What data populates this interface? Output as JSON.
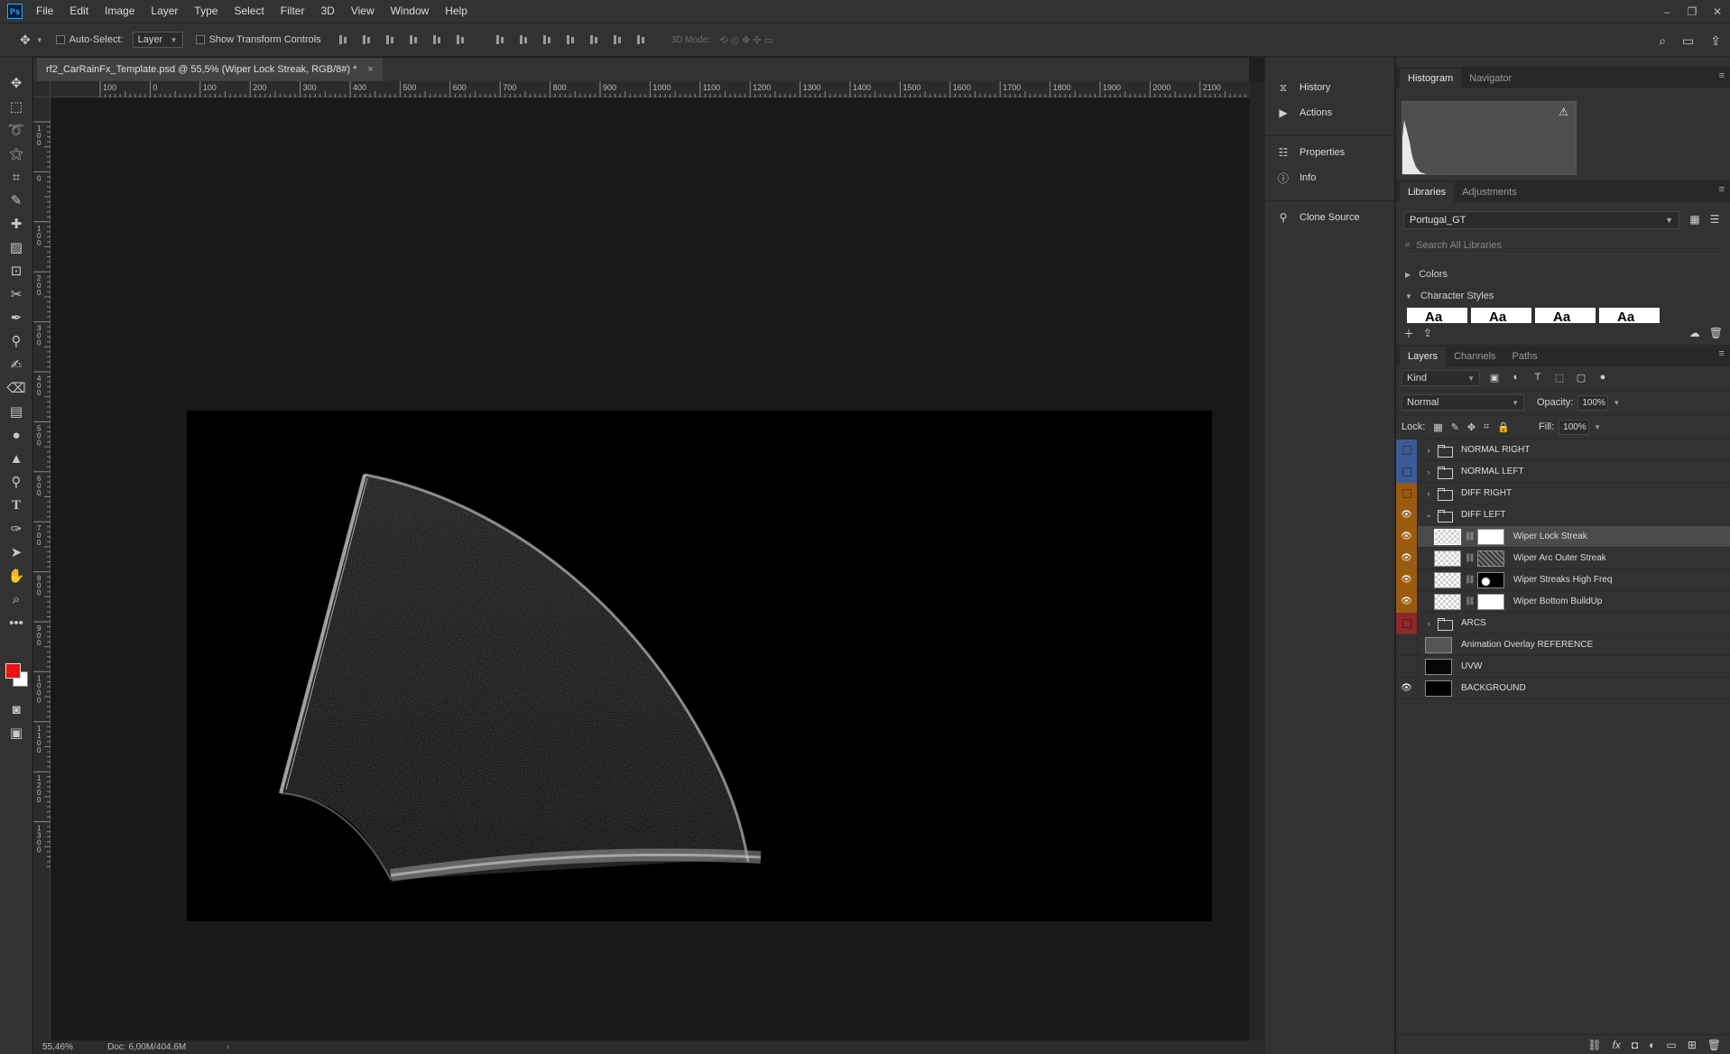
{
  "app": {
    "logo": "Ps"
  },
  "menu": [
    "File",
    "Edit",
    "Image",
    "Layer",
    "Type",
    "Select",
    "Filter",
    "3D",
    "View",
    "Window",
    "Help"
  ],
  "window_controls": [
    "–",
    "❐",
    "✕"
  ],
  "options": {
    "auto_select_label": "Auto-Select:",
    "auto_select_value": "Layer",
    "show_transform_label": "Show Transform Controls",
    "mode_3d_label": "3D Mode:"
  },
  "document": {
    "tab_title": "rf2_CarRainFx_Template.psd @ 55,5% (Wiper Lock Streak, RGB/8#) *",
    "zoom": "55,46%",
    "doc_size": "Doc: 6,00M/404,6M"
  },
  "ruler": {
    "top_labels": [
      "100",
      "0",
      "100",
      "200",
      "300",
      "400",
      "500",
      "600",
      "700",
      "800",
      "900",
      "1000",
      "1100",
      "1200",
      "1300",
      "1400",
      "1500",
      "1600",
      "1700",
      "1800",
      "1900",
      "2000",
      "2100",
      "2"
    ],
    "left_labels": [
      "100",
      "0",
      "100",
      "200",
      "300",
      "400",
      "500",
      "600",
      "700",
      "800",
      "900",
      "1000",
      "1100",
      "1200",
      "1300"
    ]
  },
  "dock": {
    "items": [
      {
        "label": "History",
        "icon": "history-icon"
      },
      {
        "label": "Actions",
        "icon": "play-icon"
      },
      {
        "label": "Properties",
        "icon": "properties-icon"
      },
      {
        "label": "Info",
        "icon": "info-icon"
      },
      {
        "label": "Clone Source",
        "icon": "clone-source-icon"
      }
    ]
  },
  "histogram_panel": {
    "tabs": [
      "Histogram",
      "Navigator"
    ]
  },
  "libraries_panel": {
    "tabs": [
      "Libraries",
      "Adjustments"
    ],
    "library": "Portugal_GT",
    "search_placeholder": "Search All Libraries",
    "sections": [
      "Colors",
      "Character Styles"
    ],
    "char_sample": "Aa"
  },
  "layers_panel": {
    "tabs": [
      "Layers",
      "Channels",
      "Paths"
    ],
    "kind": "Kind",
    "blend_mode": "Normal",
    "opacity_label": "Opacity:",
    "opacity": "100%",
    "lock_label": "Lock:",
    "fill_label": "Fill:",
    "fill": "100%",
    "layers": [
      {
        "name": "NORMAL RIGHT",
        "type": "group",
        "expanded": false,
        "visible": false,
        "color": "#3c5a96",
        "indent": 0
      },
      {
        "name": "NORMAL LEFT",
        "type": "group",
        "expanded": false,
        "visible": false,
        "color": "#3c5a96",
        "indent": 0
      },
      {
        "name": "DIFF RIGHT",
        "type": "group",
        "expanded": false,
        "visible": false,
        "color": "#9a5a10",
        "indent": 0
      },
      {
        "name": "DIFF LEFT",
        "type": "group",
        "expanded": true,
        "visible": true,
        "color": "#9a5a10",
        "indent": 0
      },
      {
        "name": "Wiper Lock Streak",
        "type": "layer",
        "visible": true,
        "color": "#9a5a10",
        "indent": 1,
        "selected": true,
        "mask": "white"
      },
      {
        "name": "Wiper Arc Outer Streak",
        "type": "layer",
        "visible": true,
        "color": "#9a5a10",
        "indent": 1,
        "mask": "noise"
      },
      {
        "name": "Wiper Streaks High Freq",
        "type": "layer",
        "visible": true,
        "color": "#9a5a10",
        "indent": 1,
        "mask": "dark"
      },
      {
        "name": "Wiper Bottom BuildUp",
        "type": "layer",
        "visible": true,
        "color": "#9a5a10",
        "indent": 1,
        "mask": "white"
      },
      {
        "name": "ARCS",
        "type": "group",
        "expanded": false,
        "visible": false,
        "color": "#8a2a2a",
        "indent": 0
      },
      {
        "name": "Animation Overlay REFERENCE",
        "type": "pixel",
        "visible": false,
        "color": "",
        "indent": 0,
        "thumb": "#555555"
      },
      {
        "name": "UVW",
        "type": "pixel",
        "visible": false,
        "color": "",
        "indent": 0,
        "thumb": "#050505"
      },
      {
        "name": "BACKGROUND",
        "type": "pixel",
        "visible": true,
        "color": "",
        "indent": 0,
        "thumb": "#000000"
      }
    ]
  },
  "colors": {
    "foreground": "#ee1111",
    "background": "#ffffff",
    "accent": "#31a8ff"
  }
}
